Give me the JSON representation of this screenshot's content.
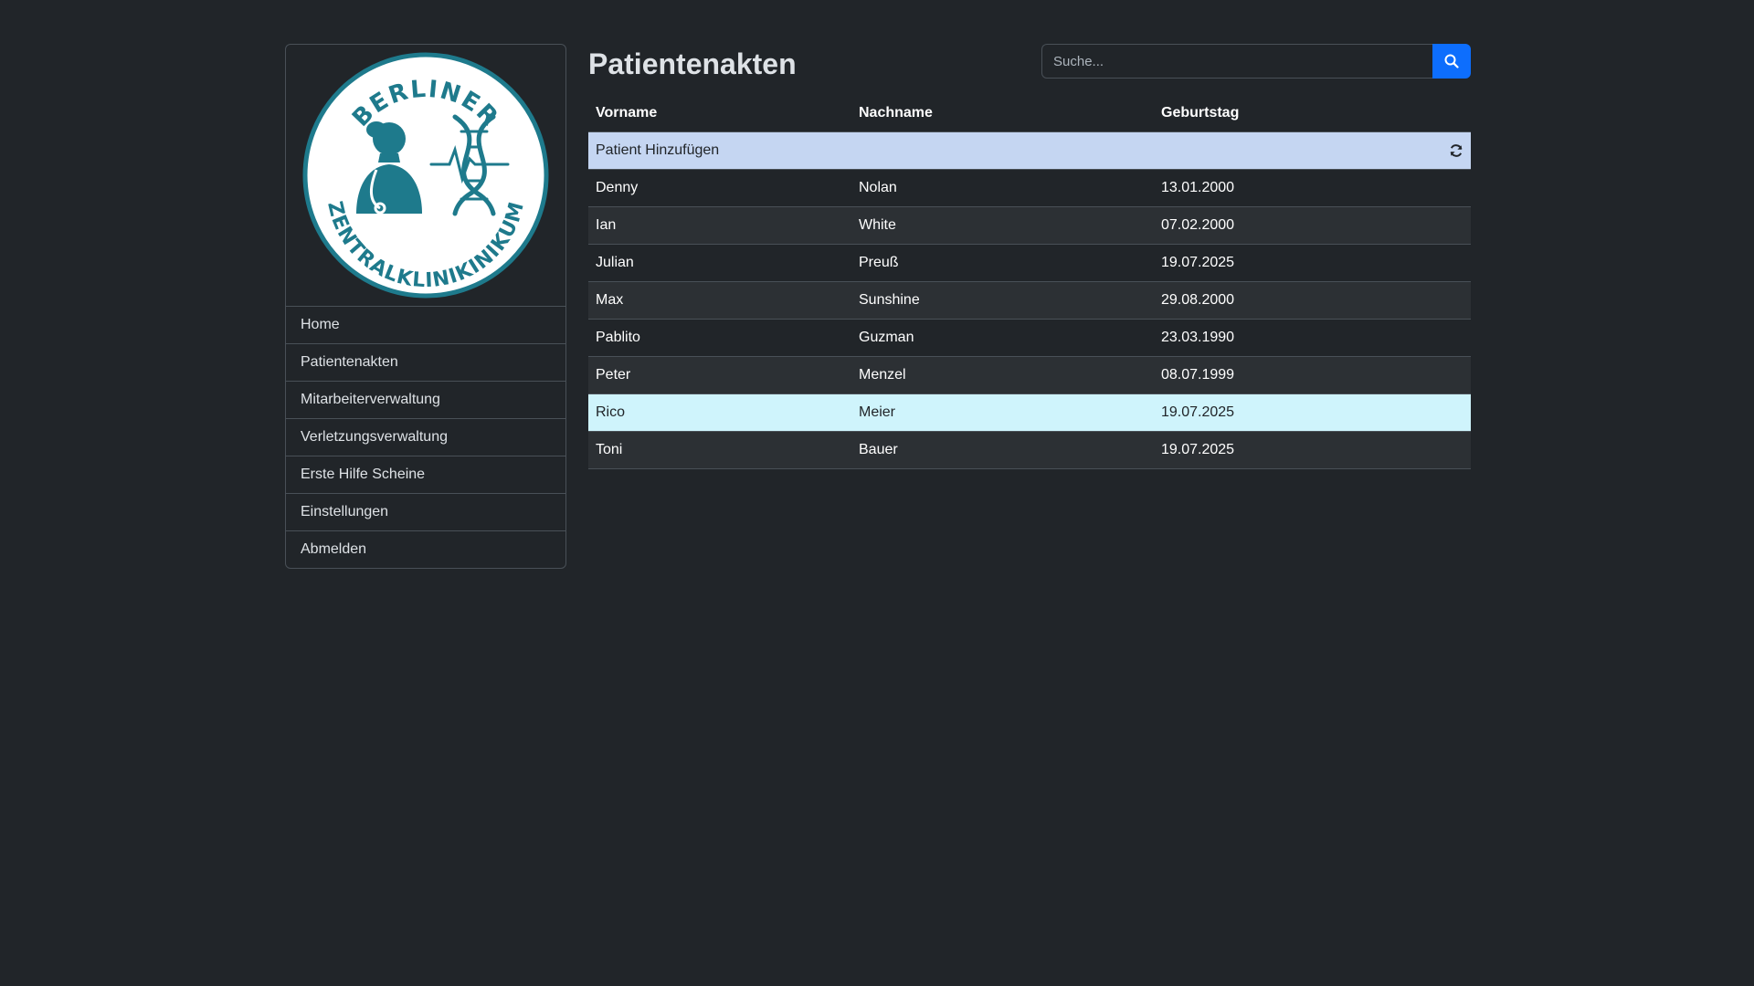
{
  "logo": {
    "top_text": "BERLINER",
    "bottom_text": "ZENTRALKLINIKINIKUM",
    "color": "#1e7a8c"
  },
  "sidebar": {
    "items": [
      {
        "label": "Home"
      },
      {
        "label": "Patientenakten"
      },
      {
        "label": "Mitarbeiterverwaltung"
      },
      {
        "label": "Verletzungsverwaltung"
      },
      {
        "label": "Erste Hilfe Scheine"
      },
      {
        "label": "Einstellungen"
      },
      {
        "label": "Abmelden"
      }
    ]
  },
  "main": {
    "title": "Patientenakten",
    "search": {
      "placeholder": "Suche...",
      "value": "",
      "icon": "search-icon"
    },
    "table": {
      "headers": {
        "first": "Vorname",
        "last": "Nachname",
        "birthday": "Geburtstag"
      },
      "add_label": "Patient Hinzufügen",
      "refresh_icon": "refresh-icon",
      "rows": [
        {
          "first": "Denny",
          "last": "Nolan",
          "birthday": "13.01.2000"
        },
        {
          "first": "Ian",
          "last": "White",
          "birthday": "07.02.2000"
        },
        {
          "first": "Julian",
          "last": "Preuß",
          "birthday": "19.07.2025"
        },
        {
          "first": "Max",
          "last": "Sunshine",
          "birthday": "29.08.2000"
        },
        {
          "first": "Pablito",
          "last": "Guzman",
          "birthday": "23.03.1990"
        },
        {
          "first": "Peter",
          "last": "Menzel",
          "birthday": "08.07.1999"
        },
        {
          "first": "Rico",
          "last": "Meier",
          "birthday": "19.07.2025"
        },
        {
          "first": "Toni",
          "last": "Bauer",
          "birthday": "19.07.2025"
        }
      ]
    }
  },
  "colors": {
    "background": "#212529",
    "accent": "#0d6efd",
    "add_row": "#c5d6f2",
    "highlight_row": "#cff4fc"
  }
}
